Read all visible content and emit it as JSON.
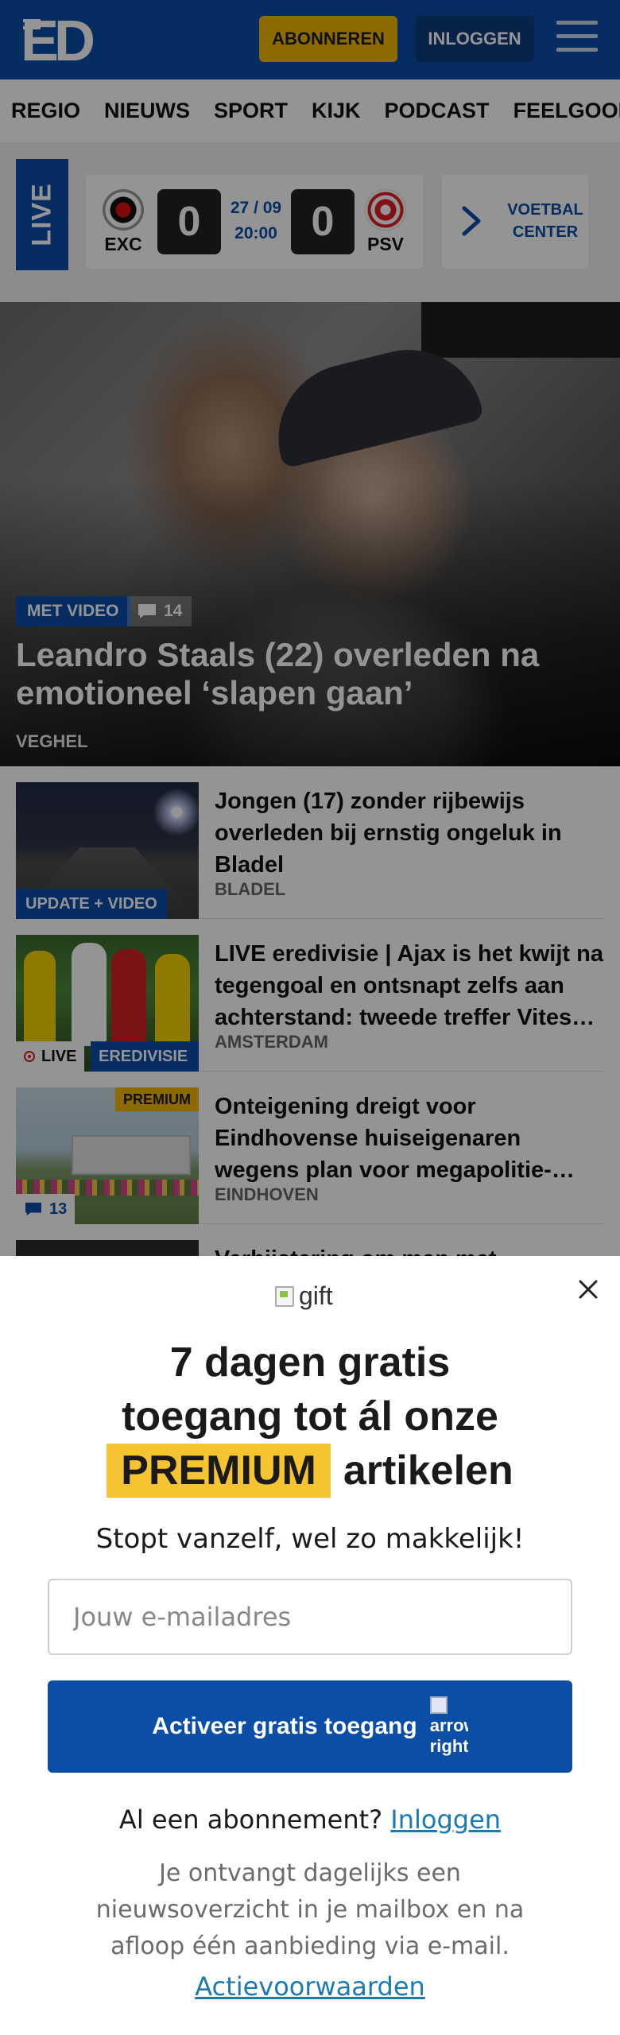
{
  "header": {
    "logo": "ED",
    "subscribe_label": "ABONNEREN",
    "login_label": "INLOGGEN"
  },
  "nav": {
    "items": [
      "REGIO",
      "NIEUWS",
      "SPORT",
      "KIJK",
      "PODCAST",
      "FEELGOOD",
      "|"
    ]
  },
  "live": {
    "label": "LIVE",
    "home_team": "EXC",
    "away_team": "PSV",
    "home_score": "0",
    "away_score": "0",
    "date": "27 / 09",
    "time": "20:00",
    "center_label": "VOETBAL CENTER"
  },
  "hero": {
    "video_tag": "MET VIDEO",
    "comments": "14",
    "title": "Leandro Staals (22) overleden na emotioneel ‘slapen gaan’",
    "location": "VEGHEL"
  },
  "articles": [
    {
      "badge": "UPDATE + VIDEO",
      "title": "Jongen (17) zonder rijbewijs overleden bij ernstig ongeluk in Bladel",
      "location": "BLADEL"
    },
    {
      "live": "LIVE",
      "category": "EREDIVISIE",
      "title": "LIVE eredivisie | Ajax is het kwijt na tegengoal en ontsnapt zelfs aan achterstand: tweede treffer Vitesse afgekeurd",
      "location": "AMSTERDAM"
    },
    {
      "premium": "PREMIUM",
      "comments": "13",
      "title": "Onteigening dreigt voor Eindhovense huiseigenaren wegens plan voor megapolitie-bureau",
      "location": "EINDHOVEN"
    },
    {
      "title": "Verbijstering om man met",
      "location": ""
    }
  ],
  "modal": {
    "gift_alt": "gift",
    "headline": "7 dagen gratis toegang tot ál onze",
    "premium_word": "PREMIUM",
    "articles_word": "artikelen",
    "subline": "Stopt vanzelf, wel zo makkelijk!",
    "email_placeholder": "Jouw e-mailadres",
    "activate_label": "Activeer gratis toegang",
    "activate_icon_alt": "arrow right",
    "already_text": "Al een abonnement?",
    "login_link": "Inloggen",
    "info": "Je ontvangt dagelijks een nieuwsoverzicht in je mailbox en na afloop één aanbieding via e-mail.",
    "terms_link": "Actievoorwaarden"
  },
  "colors": {
    "brand_blue": "#0a4ea8",
    "accent_yellow": "#f5b800",
    "link_blue": "#1a7ab5"
  }
}
